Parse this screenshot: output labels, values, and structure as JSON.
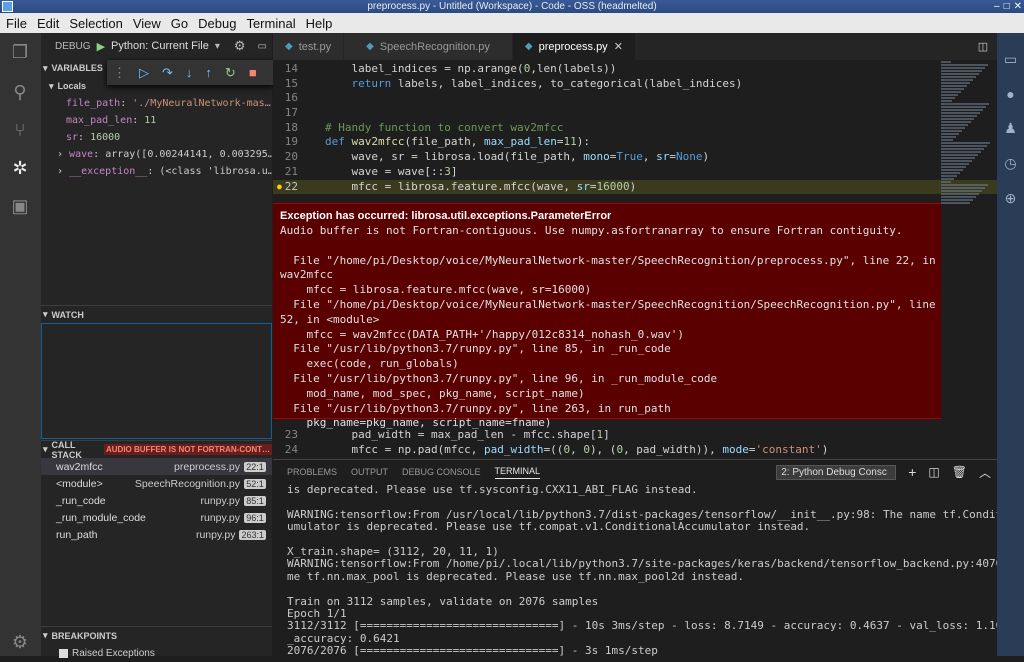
{
  "window": {
    "title": "preprocess.py - Untitled (Workspace) - Code - OSS (headmelted)",
    "buttons": [
      "–",
      "□",
      "✕"
    ]
  },
  "menu": [
    "File",
    "Edit",
    "Selection",
    "View",
    "Go",
    "Debug",
    "Terminal",
    "Help"
  ],
  "debug": {
    "label": "DEBUG",
    "config": "Python: Current File"
  },
  "variables": {
    "header": "VARIABLES",
    "locals": "Locals",
    "items": [
      {
        "name": "file_path",
        "value": "'./MyNeuralNetwork-mas…"
      },
      {
        "name": "max_pad_len",
        "value": "11"
      },
      {
        "name": "sr",
        "value": "16000"
      },
      {
        "name": "wave",
        "value": "array([0.00244141, 0.003295…"
      },
      {
        "name": "__exception__",
        "value": "(<class 'librosa.u…"
      }
    ]
  },
  "watch": {
    "header": "WATCH"
  },
  "callstack": {
    "header": "CALL STACK",
    "badge": "AUDIO BUFFER IS NOT FORTRAN-CONT…",
    "frames": [
      {
        "fn": "wav2mfcc",
        "file": "preprocess.py",
        "line": "22:1"
      },
      {
        "fn": "<module>",
        "file": "SpeechRecognition.py",
        "line": "52:1"
      },
      {
        "fn": "_run_code",
        "file": "runpy.py",
        "line": "85:1"
      },
      {
        "fn": "_run_module_code",
        "file": "runpy.py",
        "line": "96:1"
      },
      {
        "fn": "run_path",
        "file": "runpy.py",
        "line": "263:1"
      }
    ]
  },
  "breakpoints": {
    "header": "BREAKPOINTS",
    "item": "Raised Exceptions"
  },
  "tabs": [
    {
      "label": "test.py"
    },
    {
      "label": "SpeechRecognition.py"
    },
    {
      "label": "preprocess.py"
    }
  ],
  "code_top": [
    {
      "n": "14",
      "t": "    label_indices = np.arange(0,len(labels))"
    },
    {
      "n": "15",
      "t": "    return labels, label_indices, to_categorical(label_indices)"
    },
    {
      "n": "16",
      "t": ""
    },
    {
      "n": "17",
      "t": ""
    },
    {
      "n": "18",
      "t": "# Handy function to convert wav2mfcc"
    },
    {
      "n": "19",
      "t": "def wav2mfcc(file_path, max_pad_len=11):"
    },
    {
      "n": "20",
      "t": "    wave, sr = librosa.load(file_path, mono=True, sr=None)"
    },
    {
      "n": "21",
      "t": "    wave = wave[::3]"
    },
    {
      "n": "22",
      "t": "    mfcc = librosa.feature.mfcc(wave, sr=16000)"
    }
  ],
  "exception": {
    "title": "Exception has occurred: librosa.util.exceptions.ParameterError",
    "lines": [
      "Audio buffer is not Fortran-contiguous. Use numpy.asfortranarray to ensure Fortran contiguity.",
      "",
      "  File \"/home/pi/Desktop/voice/MyNeuralNetwork-master/SpeechRecognition/preprocess.py\", line 22, in",
      "wav2mfcc",
      "    mfcc = librosa.feature.mfcc(wave, sr=16000)",
      "  File \"/home/pi/Desktop/voice/MyNeuralNetwork-master/SpeechRecognition/SpeechRecognition.py\", line",
      "52, in <module>",
      "    mfcc = wav2mfcc(DATA_PATH+'/happy/012c8314_nohash_0.wav')",
      "  File \"/usr/lib/python3.7/runpy.py\", line 85, in _run_code",
      "    exec(code, run_globals)",
      "  File \"/usr/lib/python3.7/runpy.py\", line 96, in _run_module_code",
      "    mod_name, mod_spec, pkg_name, script_name)",
      "  File \"/usr/lib/python3.7/runpy.py\", line 263, in run_path",
      "    pkg_name=pkg_name, script_name=fname)"
    ]
  },
  "code_bottom": [
    {
      "n": "23",
      "t": "    pad_width = max_pad_len - mfcc.shape[1]"
    },
    {
      "n": "24",
      "t": "    mfcc = np.pad(mfcc, pad_width=((0, 0), (0, pad_width)), mode='constant')"
    }
  ],
  "panel": {
    "tabs": [
      "PROBLEMS",
      "OUTPUT",
      "DEBUG CONSOLE",
      "TERMINAL"
    ],
    "terminal_select": "2: Python Debug Consc"
  },
  "terminal": [
    "is deprecated. Please use tf.sysconfig.CXX11_ABI_FLAG instead.",
    "",
    "WARNING:tensorflow:From /usr/local/lib/python3.7/dist-packages/tensorflow/__init__.py:98: The name tf.ConditionalAc",
    "umulator is deprecated. Please use tf.compat.v1.ConditionalAccumulator instead.",
    "",
    "X_train.shape= (3112, 20, 11, 1)",
    "WARNING:tensorflow:From /home/pi/.local/lib/python3.7/site-packages/keras/backend/tensorflow_backend.py:4070: The n",
    "me tf.nn.max_pool is deprecated. Please use tf.nn.max_pool2d instead.",
    "",
    "Train on 3112 samples, validate on 2076 samples",
    "Epoch 1/1",
    "3112/3112 [==============================] - 10s 3ms/step - loss: 8.7149 - accuracy: 0.4637 - val_loss: 1.1007 - va",
    "_accuracy: 0.6421",
    "2076/2076 [==============================] - 3s 1ms/step"
  ]
}
